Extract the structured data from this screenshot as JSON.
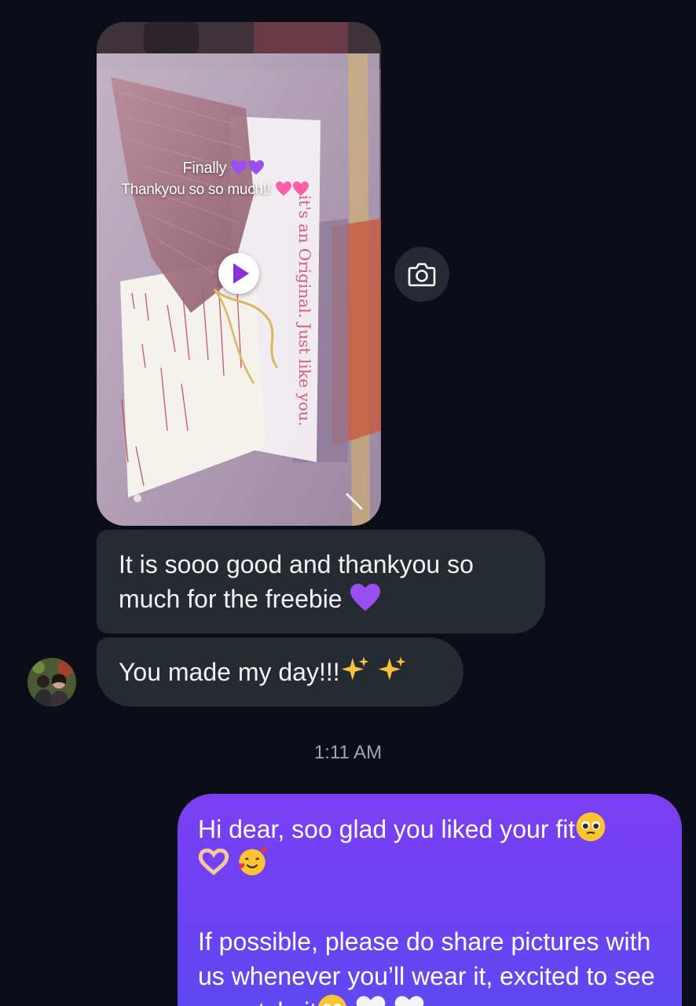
{
  "story": {
    "caption_line1": "Finally",
    "caption_line2": "Thankyou so so much!!",
    "card_text": "it's an Original. Just like you."
  },
  "messages": {
    "received_1": "It is sooo good and thankyou so much for the freebie",
    "received_2": "You made my day!!!",
    "timestamp": "1:11 AM",
    "sent_line1": "Hi dear, soo glad you liked your fit",
    "sent_line2": "If possible, please do share pictures with us whenever you’ll wear it, excited to see you style it"
  },
  "colors": {
    "background": "#0b0e16",
    "received_bubble": "#262a31",
    "sent_bubble_top": "#7b3ff2",
    "sent_bubble_bottom": "#5a4cf0",
    "timestamp": "#a2a6ae"
  },
  "icons": {
    "play": "play-icon",
    "camera": "camera-icon",
    "heart": "purple-heart-emoji",
    "sparkles": "sparkles-emoji"
  }
}
